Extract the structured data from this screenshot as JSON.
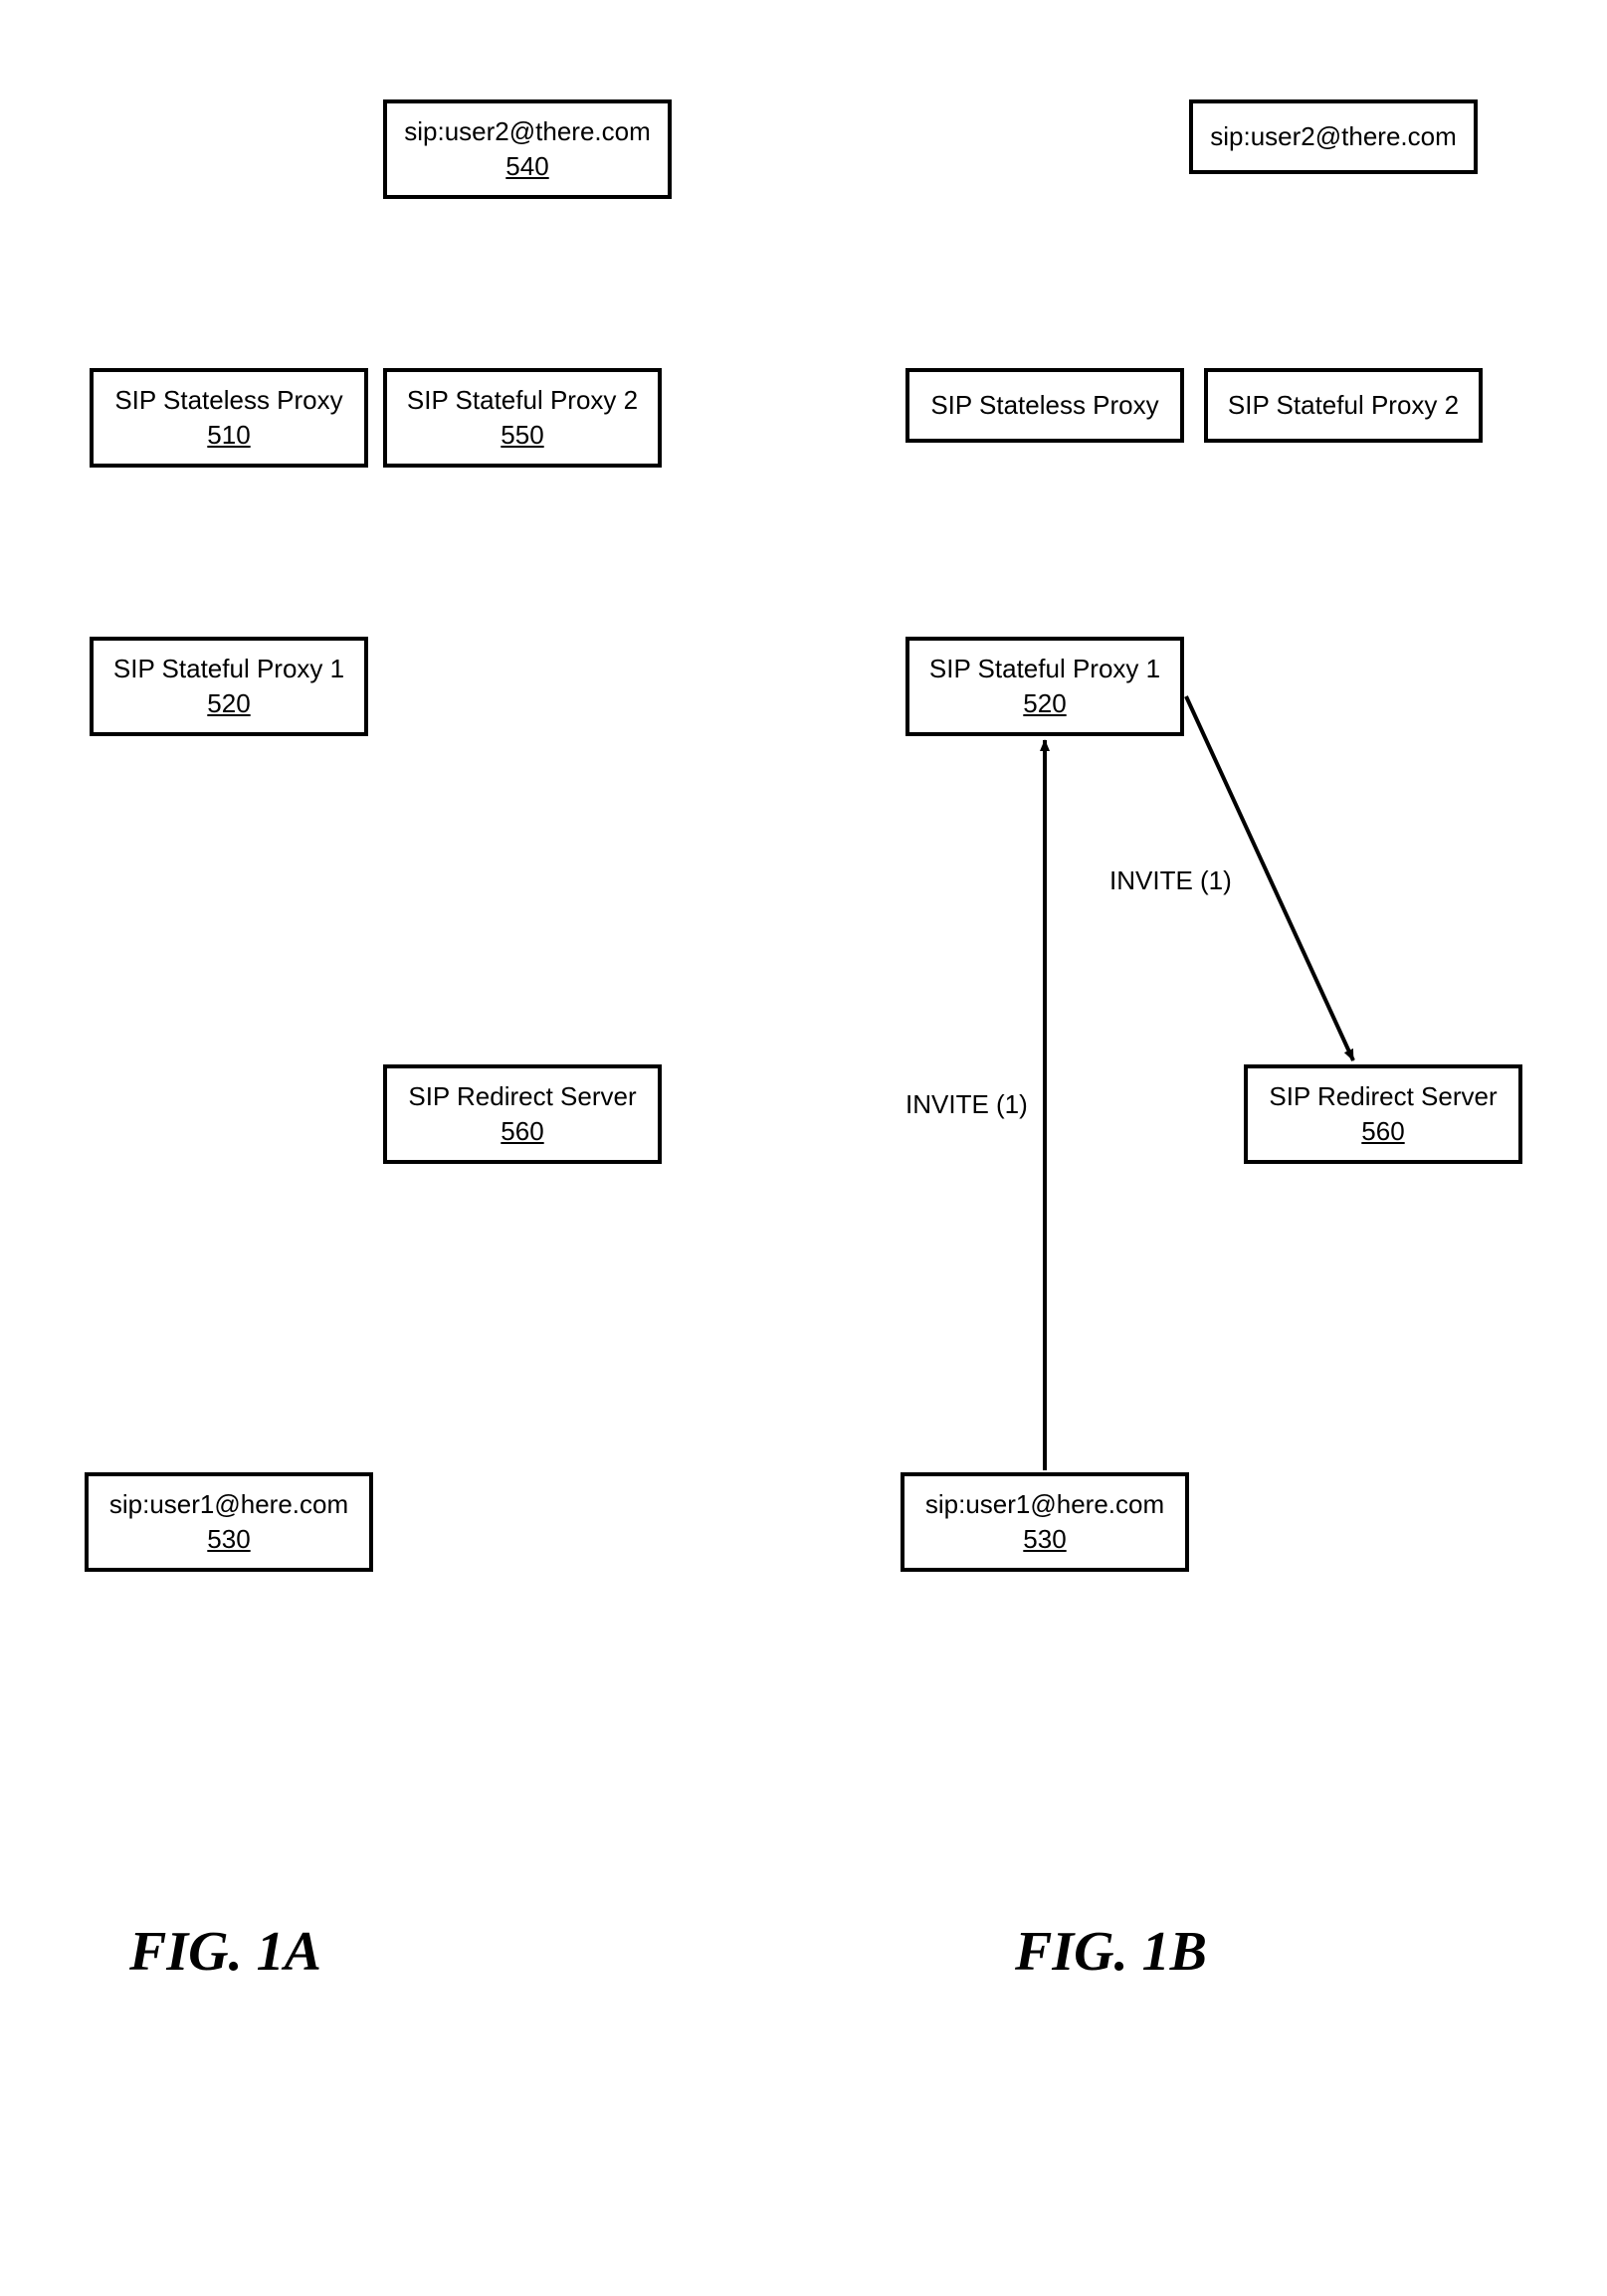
{
  "labels": {
    "user2": "sip:user2@there.com",
    "user1": "sip:user1@here.com",
    "stateless": "SIP Stateless Proxy",
    "stateful1": "SIP Stateful Proxy 1",
    "stateful2": "SIP Stateful Proxy 2",
    "redirect": "SIP Redirect Server"
  },
  "refs": {
    "user2": "540",
    "user1": "530",
    "stateless": "510",
    "stateful1": "520",
    "stateful2": "550",
    "redirect": "560"
  },
  "msgs": {
    "invite1_a": "INVITE (1)",
    "invite1_b": "INVITE (1)"
  },
  "figs": {
    "a": "FIG. 1A",
    "b": "FIG. 1B"
  }
}
